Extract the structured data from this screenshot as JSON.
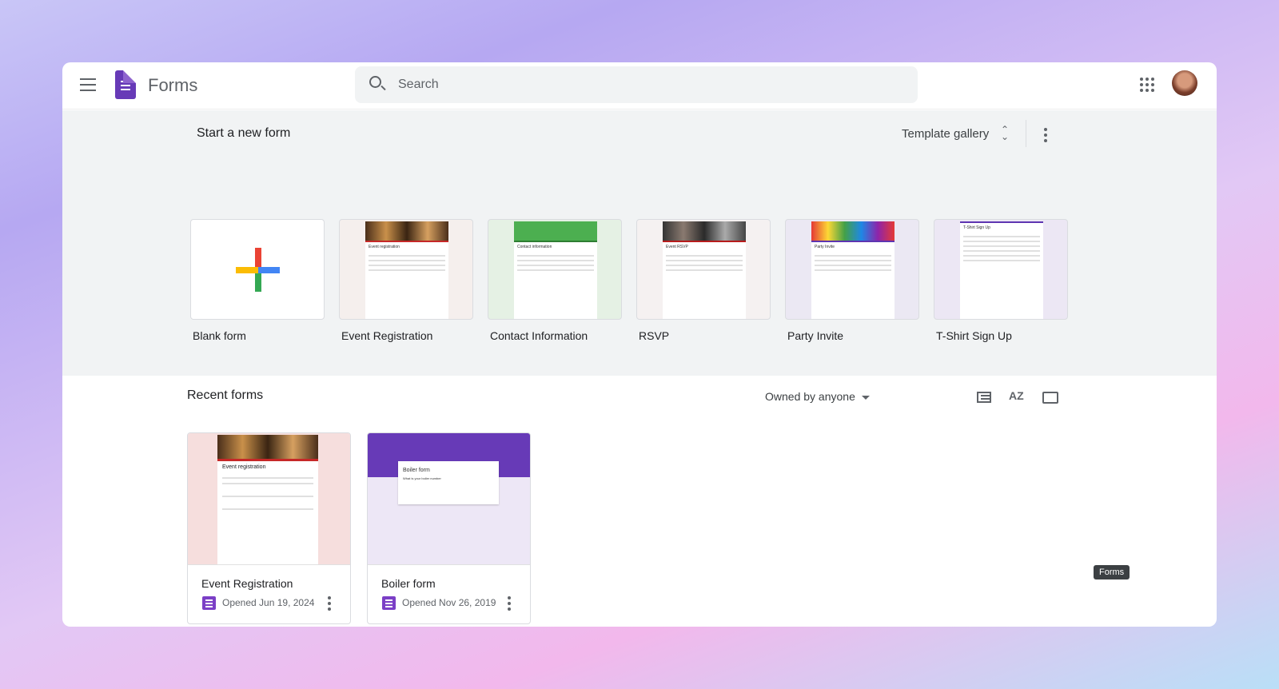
{
  "header": {
    "app_name": "Forms",
    "search_placeholder": "Search"
  },
  "templates": {
    "title": "Start a new form",
    "gallery_label": "Template gallery",
    "items": [
      {
        "label": "Blank form"
      },
      {
        "label": "Event Registration",
        "preview_title": "Event registration",
        "color": "#f5efed"
      },
      {
        "label": "Contact Information",
        "preview_title": "Contact information",
        "color": "#e5f1e4"
      },
      {
        "label": "RSVP",
        "preview_title": "Event RSVP",
        "color": "#f5f1f1"
      },
      {
        "label": "Party Invite",
        "preview_title": "Party Invite",
        "color": "#ebe8f3"
      },
      {
        "label": "T-Shirt Sign Up",
        "preview_title": "T-Shirt Sign Up",
        "color": "#ece7f4"
      }
    ]
  },
  "recent": {
    "title": "Recent forms",
    "owner_filter": "Owned by anyone",
    "sort_label": "AZ",
    "items": [
      {
        "name": "Event Registration",
        "opened": "Opened Jun 19, 2024",
        "preview_title": "Event registration"
      },
      {
        "name": "Boiler form",
        "opened": "Opened Nov 26, 2019",
        "preview_title": "Boiler form",
        "preview_question": "What is your boiler number"
      }
    ]
  },
  "tooltip": "Forms",
  "colors": {
    "brand": "#673ab7",
    "band": "#f1f3f4"
  }
}
